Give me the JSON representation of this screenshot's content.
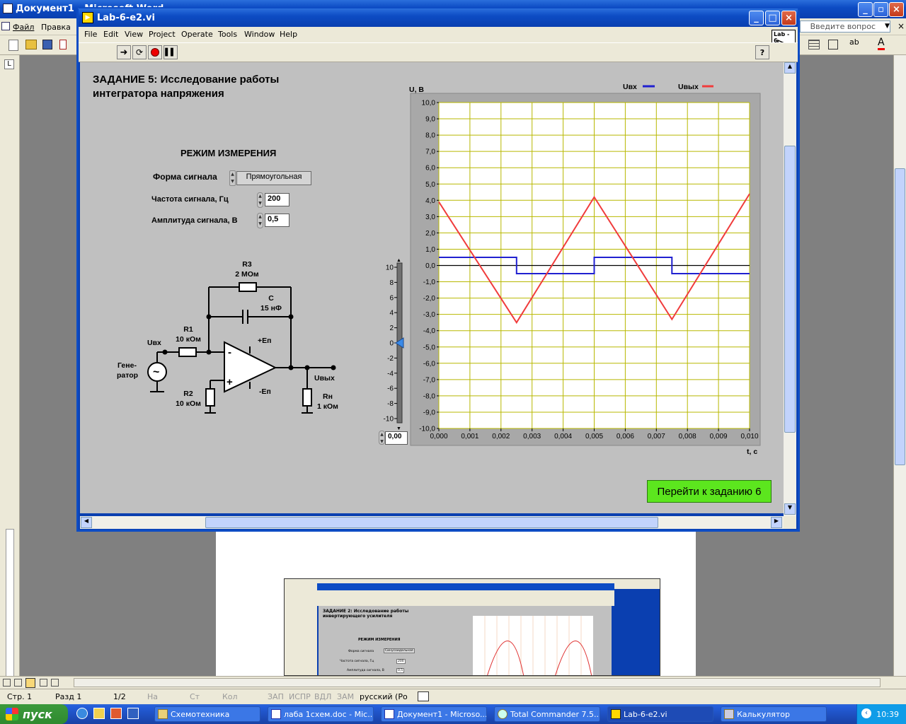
{
  "word": {
    "title": "Документ1 - Microsoft Word",
    "menu": [
      "Файл",
      "Правка"
    ],
    "help_box": "Введите вопрос",
    "status": {
      "page": "Стр. 1",
      "section": "Разд 1",
      "pages": "1/2",
      "at": "На",
      "line": "Ст",
      "col": "Кол",
      "rec": "ЗАП",
      "trk": "ИСПР",
      "ext": "ВДЛ",
      "ovr": "ЗАМ",
      "lang": "русский (Ро"
    }
  },
  "lv": {
    "title": "Lab-6-e2.vi",
    "menu": [
      "File",
      "Edit",
      "View",
      "Project",
      "Operate",
      "Tools",
      "Window",
      "Help"
    ],
    "icon_label": "Lab - 6",
    "help_glyph": "?",
    "task_title_1": "ЗАДАНИЕ 5: Исследование работы",
    "task_title_2": "интегратора напряжения",
    "mode_title": "РЕЖИМ ИЗМЕРЕНИЯ",
    "signal_form_label": "Форма сигнала",
    "signal_form_value": "Прямоугольная",
    "freq_label": "Частота сигнала, Гц",
    "freq_value": "200",
    "amp_label": "Амплитуда сигнала, В",
    "amp_value": "0,5",
    "slider_value": "0,00",
    "next_button": "Перейти к заданию 6"
  },
  "circuit": {
    "r3": "R3",
    "r3_val": "2 МОм",
    "c": "C",
    "c_val": "15 нФ",
    "r1": "R1",
    "r1_val": "10 кОм",
    "uin": "Uвх",
    "gen1": "Гене-",
    "gen2": "ратор",
    "r2": "R2",
    "r2_val": "10 кОм",
    "plus_ep": "+Eп",
    "minus_ep": "-Eп",
    "minus": "-",
    "plus": "+",
    "uout": "Uвых",
    "rn": "Rн",
    "rn_val": "1 кОм"
  },
  "slider_ticks": [
    "10",
    "8",
    "6",
    "4",
    "2",
    "0",
    "-2",
    "-4",
    "-6",
    "-8",
    "-10"
  ],
  "chart_data": {
    "type": "line",
    "ylabel": "U, B",
    "xlabel": "t, c",
    "xlim": [
      0,
      0.01
    ],
    "ylim": [
      -10,
      10
    ],
    "grid": true,
    "legend_placement": "top-right",
    "x_ticks": [
      "0,000",
      "0,001",
      "0,002",
      "0,003",
      "0,004",
      "0,005",
      "0,006",
      "0,007",
      "0,008",
      "0,009",
      "0,010"
    ],
    "y_ticks": [
      "10,0",
      "9,0",
      "8,0",
      "7,0",
      "6,0",
      "5,0",
      "4,0",
      "3,0",
      "2,0",
      "1,0",
      "0,0",
      "-1,0",
      "-2,0",
      "-3,0",
      "-4,0",
      "-5,0",
      "-6,0",
      "-7,0",
      "-8,0",
      "-9,0",
      "-10,0"
    ],
    "series": [
      {
        "name": "Uвх",
        "color": "#2020d0",
        "x": [
          0,
          0.0025,
          0.0025,
          0.005,
          0.005,
          0.0075,
          0.0075,
          0.01
        ],
        "y": [
          0.5,
          0.5,
          -0.5,
          -0.5,
          0.5,
          0.5,
          -0.5,
          -0.5
        ]
      },
      {
        "name": "Uвых",
        "color": "#f03c3c",
        "x": [
          0,
          0.0025,
          0.005,
          0.0075,
          0.01
        ],
        "y": [
          3.9,
          -3.5,
          4.2,
          -3.3,
          4.4
        ]
      }
    ]
  },
  "colors": {
    "panel": "#c0c0c0",
    "grid_bg": "#ffffff",
    "grid_line": "#b8b800",
    "next_button": "#5ce61e",
    "titlebar": "#0d4cc4"
  },
  "taskbar": {
    "start": "пуск",
    "items": [
      "Схемотехника",
      "лаба 1схем.doc - Mic...",
      "Документ1 - Microso...",
      "Total Commander 7.5...",
      "Lab-6-e2.vi",
      "Калькулятор"
    ],
    "clock": "10:39"
  },
  "thumb": {
    "title": "ЗАДАНИЕ 2: Исследование работы",
    "title2": "инвертирующего усилителя",
    "mode": "РЕЖИМ ИЗМЕРЕНИЯ",
    "form": "Форма сигнала",
    "form_val": "Синусоидальная",
    "freq": "Частота сигнала, Гц",
    "freq_val": "200",
    "amp": "Амплитуда сигнала, В",
    "amp_val": "0,5"
  }
}
